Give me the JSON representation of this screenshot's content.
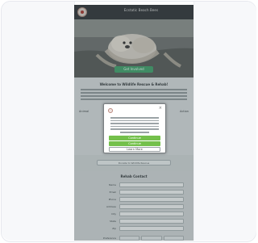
{
  "site": {
    "title": "Ecstatic Beach Bees",
    "hero_button": "Get Involved"
  },
  "section": {
    "welcome_title": "Welcome to Wildlife Rescue & Rehab!",
    "sub_left": "Animal",
    "sub_right": "Action"
  },
  "modal": {
    "close": "×",
    "primary": "Continue",
    "secondary": "Continue",
    "outline": "Learn More"
  },
  "mid_box": "Donate to Wildlife Rescue",
  "form": {
    "title": "Rehab Contact",
    "rows": [
      {
        "label": "Name"
      },
      {
        "label": "Email"
      },
      {
        "label": "Phone"
      },
      {
        "label": "Address"
      },
      {
        "label": "City"
      },
      {
        "label": "State"
      },
      {
        "label": "Zip"
      }
    ],
    "bottom_label": "Preference"
  }
}
